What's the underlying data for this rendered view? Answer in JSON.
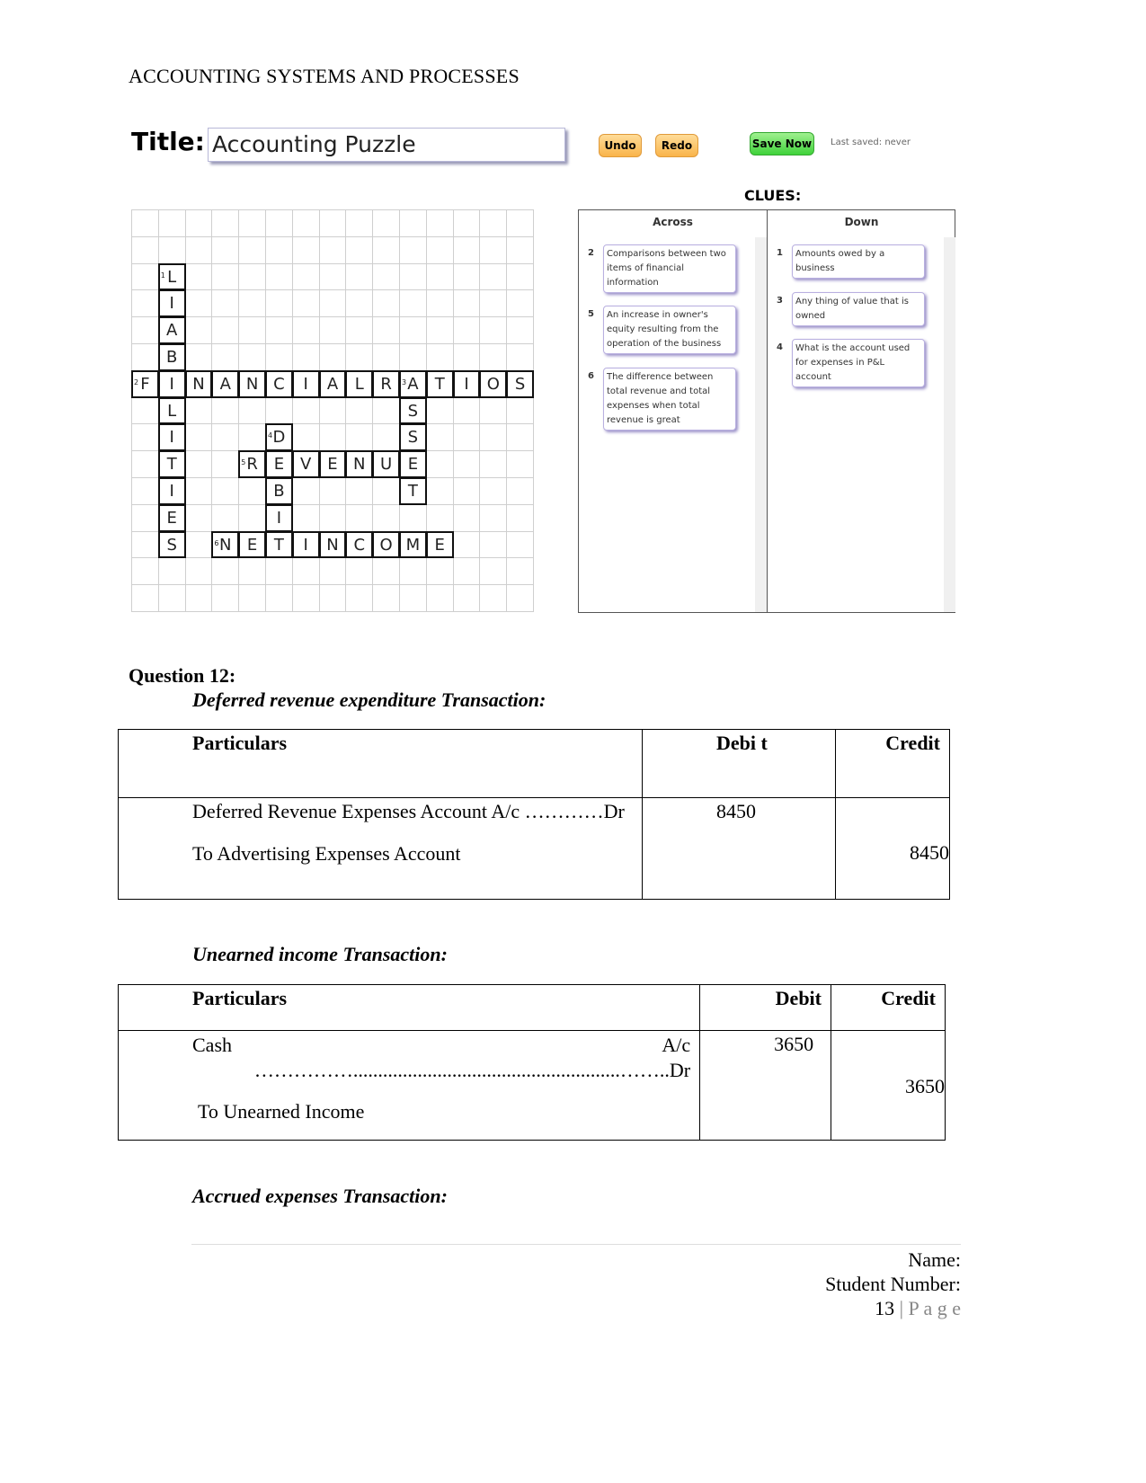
{
  "header": "ACCOUNTING SYSTEMS AND PROCESSES",
  "puzzle": {
    "title_label": "Title:",
    "title_value": "Accounting Puzzle",
    "undo": "Undo",
    "redo": "Redo",
    "save": "Save Now",
    "last_saved": "Last saved: never",
    "clues_heading": "CLUES:",
    "grid": [
      "...............",
      "...............",
      ".L.............",
      ".I.............",
      ".A.............",
      ".B.............",
      "FINANCIALRATIOS",
      ".L........S....",
      ".I...D....S....",
      ".T..REVENUE....",
      ".I...B....T....",
      ".E...I.........",
      ".S.NETINCOME...",
      "...............",
      "..............."
    ],
    "across_heading": "Across",
    "down_heading": "Down",
    "across": [
      {
        "num": "2",
        "text": "Comparisons between two items of financial information"
      },
      {
        "num": "5",
        "text": "An increase in owner's equity resulting from the operation of the business"
      },
      {
        "num": "6",
        "text": "The difference between total revenue and total expenses when total revenue is great"
      }
    ],
    "down": [
      {
        "num": "1",
        "text": "Amounts owed by a business"
      },
      {
        "num": "3",
        "text": "Any thing of value that is owned"
      },
      {
        "num": "4",
        "text": "What is the account used for expenses in P&L account"
      }
    ]
  },
  "question": {
    "label": "Question 12:",
    "t1": {
      "title": "Deferred revenue expenditure Transaction:",
      "h_particulars": "Particulars",
      "h_debit": "Debi t",
      "h_credit": "Credit",
      "line1": "Deferred Revenue Expenses Account A/c …………Dr",
      "line2": "To Advertising Expenses Account",
      "debit": "8450",
      "credit": "8450"
    },
    "t2": {
      "title": "Unearned income Transaction:",
      "h_particulars": "Particulars",
      "h_debit": "Debit",
      "h_credit": "Credit",
      "line1a": "Cash",
      "line1b": "A/c",
      "line1c": "……………......................................................……..Dr",
      "line2": "To Unearned Income",
      "debit": "3650",
      "credit": "3650"
    },
    "t3_title": "Accrued expenses Transaction:"
  },
  "footer": {
    "name": "Name:",
    "student": "Student Number:",
    "page_num": "13",
    "page_label": "| P a g e"
  }
}
